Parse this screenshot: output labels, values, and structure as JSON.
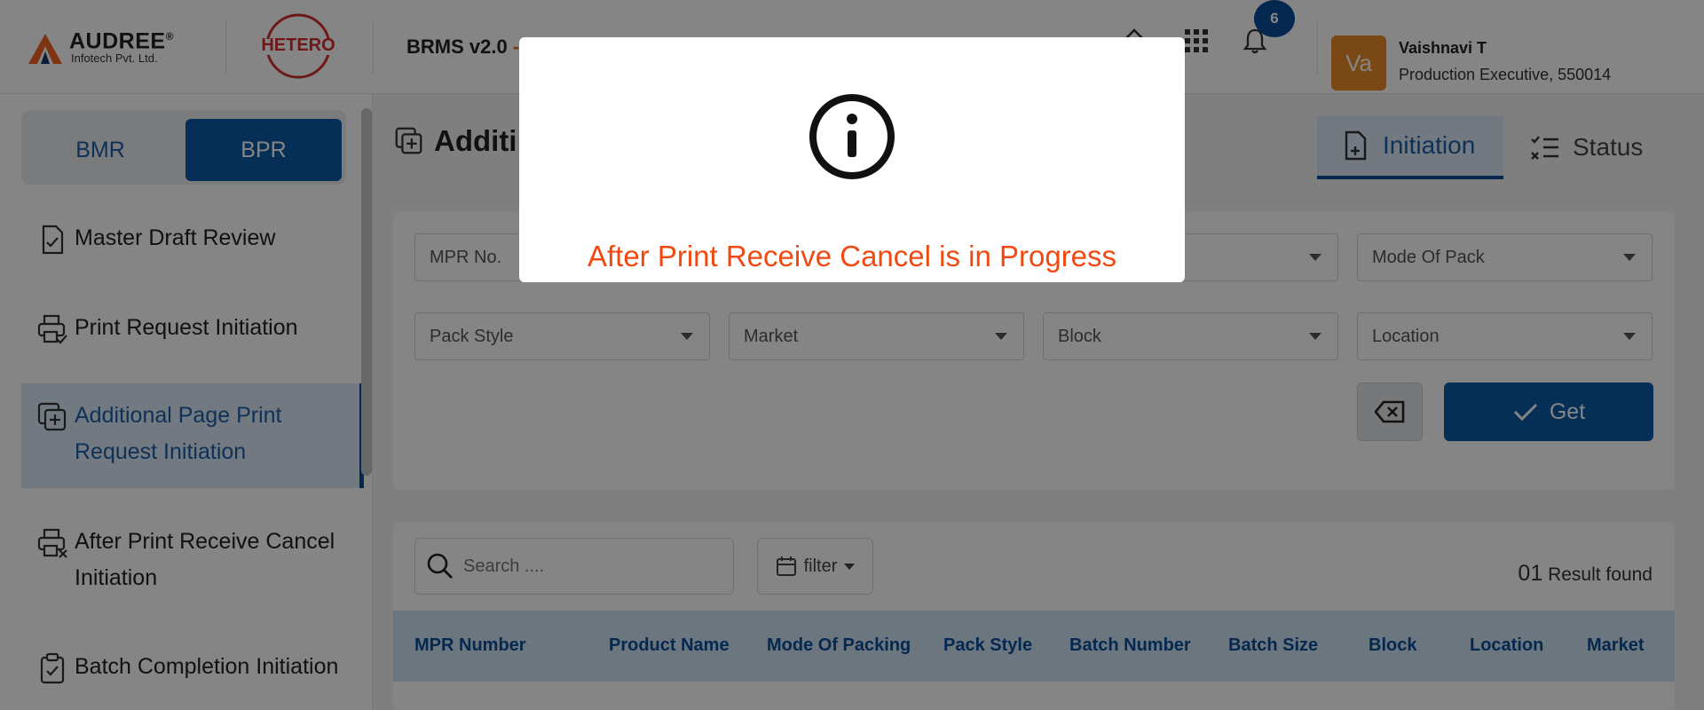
{
  "header": {
    "logo_title": "AUDREE",
    "logo_registered": "®",
    "logo_subtitle": "Infotech Pvt. Ltd.",
    "client_logo": "HETERO",
    "app_name": "BRMS v2.0",
    "app_name_suffix": "-",
    "notification_count": "6",
    "user": {
      "avatar_initials": "Va",
      "name": "Vaishnavi T",
      "role": "Production Executive, 550014"
    },
    "icons": [
      "home-icon",
      "apps-grid-icon",
      "bell-icon"
    ]
  },
  "sidebar": {
    "toggle": {
      "bmr": "BMR",
      "bpr": "BPR",
      "selected": "BPR"
    },
    "items": [
      {
        "label": "Master Draft Review",
        "icon": "document-check-icon",
        "active": false
      },
      {
        "label": "Print Request Initiation",
        "icon": "printer-check-icon",
        "active": false
      },
      {
        "label": "Additional Page Print Request Initiation",
        "icon": "add-copy-icon",
        "active": true
      },
      {
        "label": "After Print Receive Cancel Initiation",
        "icon": "printer-cancel-icon",
        "active": false
      },
      {
        "label": "Batch Completion Initiation",
        "icon": "clipboard-check-icon",
        "active": false
      }
    ]
  },
  "main": {
    "page_title": "Additi",
    "tabs": [
      {
        "label": "Initiation",
        "active": true
      },
      {
        "label": "Status",
        "active": false
      }
    ],
    "filters": {
      "mpr_no": "MPR No.",
      "mode_of_pack": "Mode Of Pack",
      "pack_style": "Pack Style",
      "market": "Market",
      "block": "Block",
      "location": "Location"
    },
    "get_label": "Get",
    "search_placeholder": "Search ....",
    "filter_label": "filter",
    "result_count": "01",
    "result_text": "Result found",
    "table_headers": [
      "MPR Number",
      "Product Name",
      "Mode Of Packing",
      "Pack Style",
      "Batch Number",
      "Batch Size",
      "Block",
      "Location",
      "Market"
    ]
  },
  "modal": {
    "icon": "info-icon",
    "message": "After Print Receive Cancel is in Progress"
  },
  "colors": {
    "primary": "#0b5aa5",
    "accent": "#f26522",
    "modal_message": "#f04a12",
    "active_bg": "#dbe9f6",
    "table_header_bg": "#cfe2f3"
  }
}
